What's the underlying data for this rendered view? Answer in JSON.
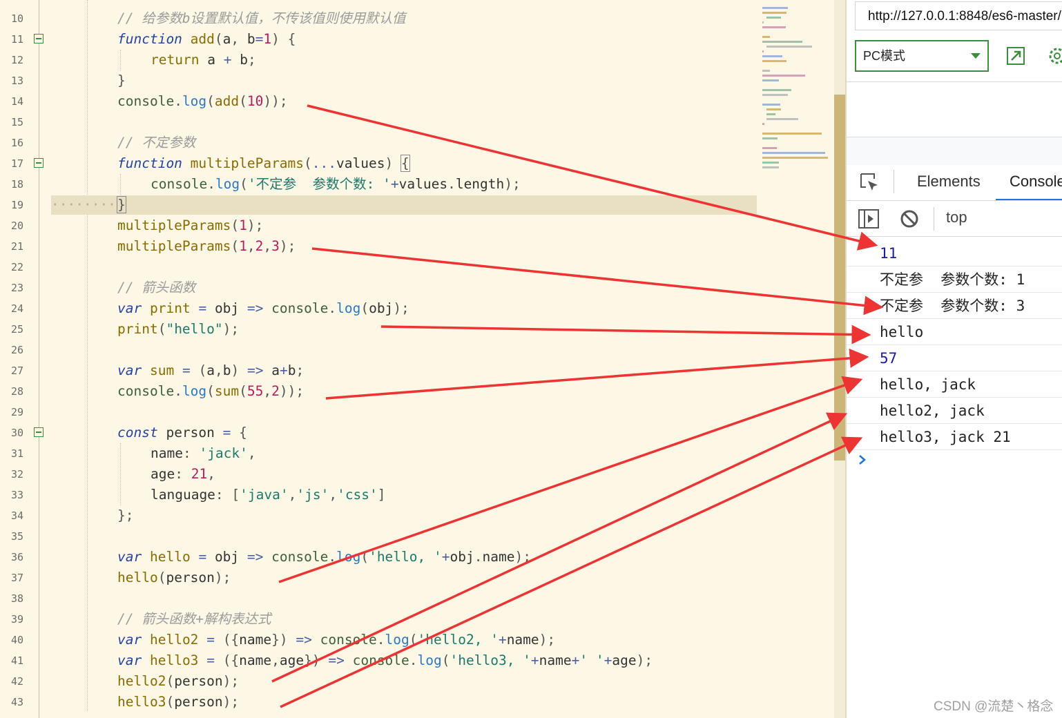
{
  "editor": {
    "lines": [
      {
        "n": "10",
        "html": "<span class=\"cm\">// 给参数b设置默认值，不传该值则使用默认值</span>",
        "indent": 1
      },
      {
        "n": "11",
        "fold": true,
        "html": "<span class=\"kw\">function</span> <span class=\"fn\">add</span><span class=\"pn\">(</span><span class=\"tx\">a</span><span class=\"pn\">, </span><span class=\"tx\">b</span><span class=\"op\">=</span><span class=\"num\">1</span><span class=\"pn\">) {</span>",
        "indent": 1
      },
      {
        "n": "12",
        "html": "<span class=\"kw2\">return</span> <span class=\"tx\">a</span> <span class=\"op\">+</span> <span class=\"tx\">b</span><span class=\"pn\">;</span>",
        "indent": 2
      },
      {
        "n": "13",
        "html": "<span class=\"pn\">}</span>",
        "indent": 1
      },
      {
        "n": "14",
        "html": "<span class=\"id\">console</span><span class=\"pn\">.</span><span class=\"prop\">log</span><span class=\"pn\">(</span><span class=\"fn\">add</span><span class=\"pn\">(</span><span class=\"num\">10</span><span class=\"pn\">));</span>",
        "indent": 1
      },
      {
        "n": "15",
        "html": "",
        "indent": 1
      },
      {
        "n": "16",
        "html": "<span class=\"cm\">// 不定参数</span>",
        "indent": 1
      },
      {
        "n": "17",
        "fold": true,
        "html": "<span class=\"kw\">function</span> <span class=\"fn\">multipleParams</span><span class=\"pn\">(</span><span class=\"op\">...</span><span class=\"tx\">values</span><span class=\"pn\">) </span><span class=\"pn brk\">{</span>",
        "indent": 1
      },
      {
        "n": "18",
        "html": "<span class=\"id\">console</span><span class=\"pn\">.</span><span class=\"prop\">log</span><span class=\"pn\">(</span><span class=\"str\">'不定参  参数个数: '</span><span class=\"op\">+</span><span class=\"tx\">values</span><span class=\"pn\">.</span><span class=\"tx\">length</span><span class=\"pn\">);</span>",
        "indent": 2
      },
      {
        "n": "19",
        "current": true,
        "html": "<span class=\"pn brk\">}</span>",
        "indent": 1
      },
      {
        "n": "20",
        "html": "<span class=\"fn\">multipleParams</span><span class=\"pn\">(</span><span class=\"num\">1</span><span class=\"pn\">);</span>",
        "indent": 1
      },
      {
        "n": "21",
        "html": "<span class=\"fn\">multipleParams</span><span class=\"pn\">(</span><span class=\"num\">1</span><span class=\"pn\">,</span><span class=\"num\">2</span><span class=\"pn\">,</span><span class=\"num\">3</span><span class=\"pn\">);</span>",
        "indent": 1
      },
      {
        "n": "22",
        "html": "",
        "indent": 1
      },
      {
        "n": "23",
        "html": "<span class=\"cm\">// 箭头函数</span>",
        "indent": 1
      },
      {
        "n": "24",
        "html": "<span class=\"kw\">var</span> <span class=\"fn\">print</span> <span class=\"op\">=</span> <span class=\"tx\">obj</span> <span class=\"op\">=&gt;</span> <span class=\"id\">console</span><span class=\"pn\">.</span><span class=\"prop\">log</span><span class=\"pn\">(</span><span class=\"tx\">obj</span><span class=\"pn\">);</span>",
        "indent": 1
      },
      {
        "n": "25",
        "html": "<span class=\"fn\">print</span><span class=\"pn\">(</span><span class=\"str\">\"hello\"</span><span class=\"pn\">);</span>",
        "indent": 1
      },
      {
        "n": "26",
        "html": "",
        "indent": 1
      },
      {
        "n": "27",
        "html": "<span class=\"kw\">var</span> <span class=\"fn\">sum</span> <span class=\"op\">=</span> <span class=\"pn\">(</span><span class=\"tx\">a</span><span class=\"pn\">,</span><span class=\"tx\">b</span><span class=\"pn\">)</span> <span class=\"op\">=&gt;</span> <span class=\"tx\">a</span><span class=\"op\">+</span><span class=\"tx\">b</span><span class=\"pn\">;</span>",
        "indent": 1
      },
      {
        "n": "28",
        "html": "<span class=\"id\">console</span><span class=\"pn\">.</span><span class=\"prop\">log</span><span class=\"pn\">(</span><span class=\"fn\">sum</span><span class=\"pn\">(</span><span class=\"num\">55</span><span class=\"pn\">,</span><span class=\"num\">2</span><span class=\"pn\">));</span>",
        "indent": 1
      },
      {
        "n": "29",
        "html": "",
        "indent": 1
      },
      {
        "n": "30",
        "fold": true,
        "html": "<span class=\"kw\">const</span> <span class=\"tx\">person</span> <span class=\"op\">=</span> <span class=\"pn\">{</span>",
        "indent": 1
      },
      {
        "n": "31",
        "html": "<span class=\"tx\">name</span><span class=\"pn\">: </span><span class=\"str\">'jack'</span><span class=\"pn\">,</span>",
        "indent": 2
      },
      {
        "n": "32",
        "html": "<span class=\"tx\">age</span><span class=\"pn\">: </span><span class=\"num\">21</span><span class=\"pn\">,</span>",
        "indent": 2
      },
      {
        "n": "33",
        "html": "<span class=\"tx\">language</span><span class=\"pn\">: [</span><span class=\"str\">'java'</span><span class=\"pn\">,</span><span class=\"str\">'js'</span><span class=\"pn\">,</span><span class=\"str\">'css'</span><span class=\"pn\">]</span>",
        "indent": 2
      },
      {
        "n": "34",
        "html": "<span class=\"pn\">};</span>",
        "indent": 1
      },
      {
        "n": "35",
        "html": "",
        "indent": 1
      },
      {
        "n": "36",
        "html": "<span class=\"kw\">var</span> <span class=\"fn\">hello</span> <span class=\"op\">=</span> <span class=\"tx\">obj</span> <span class=\"op\">=&gt;</span> <span class=\"id\">console</span><span class=\"pn\">.</span><span class=\"prop\">log</span><span class=\"pn\">(</span><span class=\"str\">'hello, '</span><span class=\"op\">+</span><span class=\"tx\">obj</span><span class=\"pn\">.</span><span class=\"tx\">name</span><span class=\"pn\">);</span>",
        "indent": 1
      },
      {
        "n": "37",
        "html": "<span class=\"fn\">hello</span><span class=\"pn\">(</span><span class=\"tx\">person</span><span class=\"pn\">);</span>",
        "indent": 1
      },
      {
        "n": "38",
        "html": "",
        "indent": 1
      },
      {
        "n": "39",
        "html": "<span class=\"cm\">// 箭头函数+解构表达式</span>",
        "indent": 1
      },
      {
        "n": "40",
        "html": "<span class=\"kw\">var</span> <span class=\"fn\">hello2</span> <span class=\"op\">=</span> <span class=\"pn\">({</span><span class=\"tx\">name</span><span class=\"pn\">})</span> <span class=\"op\">=&gt;</span> <span class=\"id\">console</span><span class=\"pn\">.</span><span class=\"prop\">log</span><span class=\"pn\">(</span><span class=\"str\">'hello2, '</span><span class=\"op\">+</span><span class=\"tx\">name</span><span class=\"pn\">);</span>",
        "indent": 1
      },
      {
        "n": "41",
        "html": "<span class=\"kw\">var</span> <span class=\"fn\">hello3</span> <span class=\"op\">=</span> <span class=\"pn\">({</span><span class=\"tx\">name</span><span class=\"pn\">,</span><span class=\"tx\">age</span><span class=\"pn\">})</span> <span class=\"op\">=&gt;</span> <span class=\"id\">console</span><span class=\"pn\">.</span><span class=\"prop\">log</span><span class=\"pn\">(</span><span class=\"str\">'hello3, '</span><span class=\"op\">+</span><span class=\"tx\">name</span><span class=\"op\">+</span><span class=\"str\">' '</span><span class=\"op\">+</span><span class=\"tx\">age</span><span class=\"pn\">);</span>",
        "indent": 1
      },
      {
        "n": "42",
        "html": "<span class=\"fn\">hello2</span><span class=\"pn\">(</span><span class=\"tx\">person</span><span class=\"pn\">);</span>",
        "indent": 1
      },
      {
        "n": "43",
        "html": "<span class=\"fn\">hello3</span><span class=\"pn\">(</span><span class=\"tx\">person</span><span class=\"pn\">);</span>",
        "indent": 1
      }
    ]
  },
  "browser": {
    "url": "http://127.0.0.1:8848/es6-master/",
    "mode": "PC模式"
  },
  "devtools": {
    "tab_elements": "Elements",
    "tab_console": "Console",
    "context": "top"
  },
  "console": {
    "messages": [
      {
        "text": "11",
        "kind": "number"
      },
      {
        "text": "不定参  参数个数: 1",
        "kind": "string"
      },
      {
        "text": "不定参  参数个数: 3",
        "kind": "string"
      },
      {
        "text": "hello",
        "kind": "string"
      },
      {
        "text": "57",
        "kind": "number"
      },
      {
        "text": "hello, jack",
        "kind": "string"
      },
      {
        "text": "hello2, jack",
        "kind": "string"
      },
      {
        "text": "hello3, jack 21",
        "kind": "string"
      }
    ]
  },
  "watermark": "CSDN @流楚丶格念",
  "colors": {
    "annotation_arrow": "#ee3333",
    "editor_background": "#fdf8e6",
    "active_tab": "#1a73e8"
  }
}
